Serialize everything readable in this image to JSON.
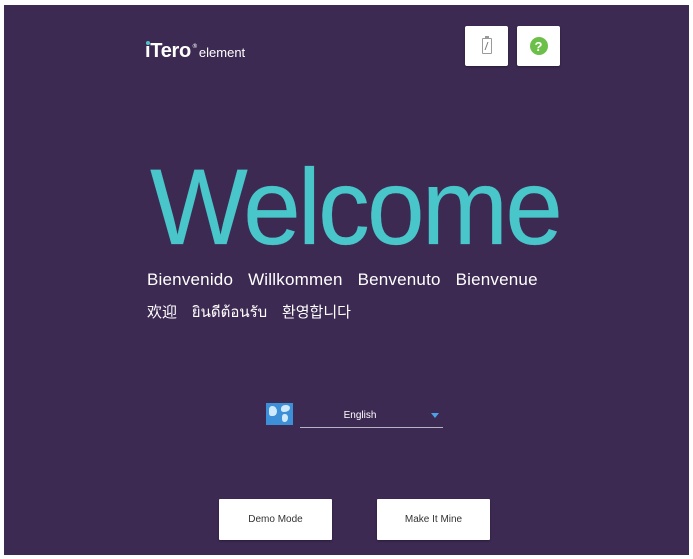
{
  "logo": {
    "brand": "iTero",
    "registered": "®",
    "product": "element"
  },
  "toolbar": {
    "battery_icon": "battery-icon",
    "help_icon": "help-icon",
    "help_glyph": "?"
  },
  "welcome": {
    "title": "Welcome",
    "greetings_line1": [
      "Bienvenido",
      "Willkommen",
      "Benvenuto",
      "Bienvenue"
    ],
    "greetings_line2": [
      "欢迎",
      "ยินดีต้อนรับ",
      "환영합니다"
    ]
  },
  "language": {
    "icon": "globe-icon",
    "selected": "English"
  },
  "buttons": {
    "demo_mode": "Demo Mode",
    "make_it_mine": "Make It Mine"
  },
  "colors": {
    "background": "#3d2a53",
    "accent": "#48c6c9",
    "help_green": "#6cc04a",
    "caret_blue": "#4aa3e8"
  }
}
